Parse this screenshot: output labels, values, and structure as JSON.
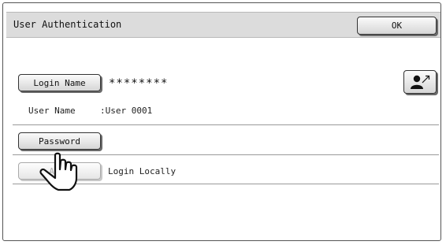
{
  "title_bar": {
    "title": "User Authentication",
    "ok_label": "OK"
  },
  "login_name": {
    "button_label": "Login Name",
    "value": "********"
  },
  "user_name": {
    "label": "User Name",
    "value": ":User 0001"
  },
  "password": {
    "button_label": "Password"
  },
  "auth": {
    "button_label": "Auth",
    "value": "Login Locally"
  },
  "icons": {
    "user_select": "user-select-icon",
    "pointer": "pointing-hand-icon"
  }
}
